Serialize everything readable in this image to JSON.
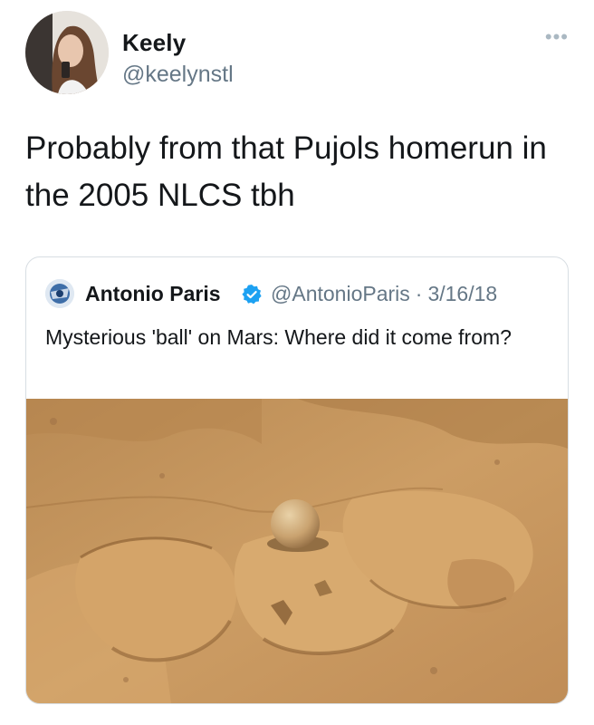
{
  "tweet": {
    "author": {
      "name": "Keely",
      "handle": "@keelynstl",
      "avatar_icon": "profile-photo-icon"
    },
    "more_label": "•••",
    "text": "Probably from that Pujols homerun in the 2005 NLCS tbh"
  },
  "quoted_tweet": {
    "author": {
      "name": "Antonio Paris",
      "verified": true,
      "verified_icon": "verified-badge-icon",
      "handle": "@AntonioParis",
      "separator": "·",
      "date": "3/16/18",
      "avatar_icon": "profile-photo-icon"
    },
    "text": "Mysterious 'ball' on Mars: Where did it come from?",
    "media": {
      "type": "photo",
      "subject": "mars-rock-ball-photo"
    }
  },
  "colors": {
    "text_primary": "#14171a",
    "text_secondary": "#657786",
    "verified_blue": "#1da1f2",
    "border": "#d8dee3",
    "mars_sand": "#c99860"
  }
}
